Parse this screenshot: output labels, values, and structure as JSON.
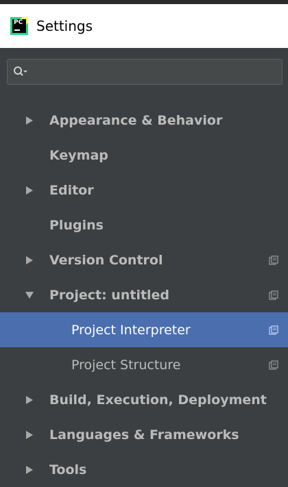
{
  "window": {
    "title": "Settings",
    "app_icon": "pycharm-icon",
    "app_icon_text": "PC"
  },
  "search": {
    "value": "",
    "icon": "search-icon"
  },
  "tree": {
    "items": [
      {
        "label": "Appearance & Behavior",
        "arrow": "collapsed",
        "copy_icon": false,
        "selected": false
      },
      {
        "label": "Keymap",
        "arrow": "none",
        "copy_icon": false,
        "selected": false
      },
      {
        "label": "Editor",
        "arrow": "collapsed",
        "copy_icon": false,
        "selected": false
      },
      {
        "label": "Plugins",
        "arrow": "none",
        "copy_icon": false,
        "selected": false
      },
      {
        "label": "Version Control",
        "arrow": "collapsed",
        "copy_icon": true,
        "selected": false
      },
      {
        "label": "Project: untitled",
        "arrow": "expanded",
        "copy_icon": true,
        "selected": false
      },
      {
        "label": "Project Interpreter",
        "arrow": "none",
        "copy_icon": true,
        "selected": true
      },
      {
        "label": "Project Structure",
        "arrow": "none",
        "copy_icon": true,
        "selected": false
      },
      {
        "label": "Build, Execution, Deployment",
        "arrow": "collapsed",
        "copy_icon": false,
        "selected": false
      },
      {
        "label": "Languages & Frameworks",
        "arrow": "collapsed",
        "copy_icon": false,
        "selected": false
      },
      {
        "label": "Tools",
        "arrow": "collapsed",
        "copy_icon": false,
        "selected": false
      }
    ]
  },
  "colors": {
    "background": "#3c3f41",
    "selection": "#4b6eaf",
    "text": "#bbbbbb",
    "selected_text": "#ffffff"
  }
}
